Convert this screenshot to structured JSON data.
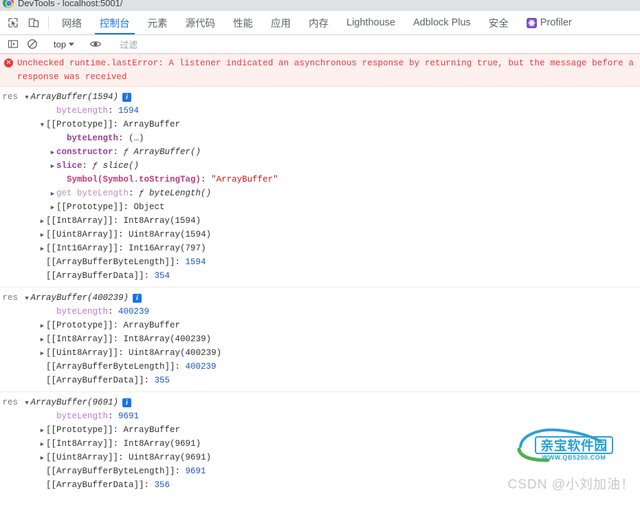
{
  "window": {
    "title": "DevTools - localhost:5001/",
    "chrome_logo": "chrome-logo-icon"
  },
  "toolbar": {
    "inspect_icon": "inspect-element-icon",
    "device_icon": "device-toolbar-icon",
    "tabs": [
      {
        "label": "网络",
        "active": false,
        "icon": null
      },
      {
        "label": "控制台",
        "active": true,
        "icon": null
      },
      {
        "label": "元素",
        "active": false,
        "icon": null
      },
      {
        "label": "源代码",
        "active": false,
        "icon": null
      },
      {
        "label": "性能",
        "active": false,
        "icon": null
      },
      {
        "label": "应用",
        "active": false,
        "icon": null
      },
      {
        "label": "内存",
        "active": false,
        "icon": null
      },
      {
        "label": "Lighthouse",
        "active": false,
        "icon": null
      },
      {
        "label": "Adblock Plus",
        "active": false,
        "icon": null
      },
      {
        "label": "安全",
        "active": false,
        "icon": null
      },
      {
        "label": "Profiler",
        "active": false,
        "icon": "profiler-icon"
      }
    ],
    "accent_color": "#1a73e8"
  },
  "filterbar": {
    "sidebar_toggle_icon": "console-sidebar-icon",
    "clear_icon": "clear-console-icon",
    "context": "top",
    "eye_icon": "live-expression-icon",
    "filter_placeholder": "过滤",
    "filter_value": ""
  },
  "console": {
    "error": {
      "badge": "error-icon",
      "text": "Unchecked runtime.lastError: A listener indicated an asynchronous response by returning true, but the message before a response was received",
      "color": "#e53935",
      "background": "#fff0f0"
    },
    "groups": [
      {
        "label": "res",
        "title": "ArrayBuffer(1594)",
        "info_icon": "info-icon",
        "expanded": true,
        "rows": [
          {
            "indent": 3,
            "arrow": "none",
            "key": "byteLength",
            "key_style": "prop",
            "value": "1594",
            "value_style": "num"
          },
          {
            "indent": 2,
            "arrow": "open",
            "key": "[[Prototype]]",
            "key_style": "plain",
            "value": "ArrayBuffer",
            "value_style": "obj"
          },
          {
            "indent": 4,
            "arrow": "none",
            "key": "byteLength",
            "key_style": "proto",
            "value": "(…)",
            "value_style": "dots"
          },
          {
            "indent": 3,
            "arrow": "closed",
            "key": "constructor",
            "key_style": "proto",
            "value": "ƒ ArrayBuffer()",
            "value_style": "fn"
          },
          {
            "indent": 3,
            "arrow": "closed",
            "key": "slice",
            "key_style": "proto",
            "value": "ƒ slice()",
            "value_style": "fn"
          },
          {
            "indent": 4,
            "arrow": "none",
            "key": "Symbol(Symbol.toStringTag)",
            "key_style": "sym",
            "value": "\"ArrayBuffer\"",
            "value_style": "str"
          },
          {
            "indent": 3,
            "arrow": "closed",
            "key": "get byteLength",
            "key_style": "getter",
            "value": "ƒ byteLength()",
            "value_style": "fn"
          },
          {
            "indent": 3,
            "arrow": "closed",
            "key": "[[Prototype]]",
            "key_style": "plain",
            "value": "Object",
            "value_style": "obj"
          },
          {
            "indent": 2,
            "arrow": "closed",
            "key": "[[Int8Array]]",
            "key_style": "plain",
            "value": "Int8Array(1594)",
            "value_style": "obj"
          },
          {
            "indent": 2,
            "arrow": "closed",
            "key": "[[Uint8Array]]",
            "key_style": "plain",
            "value": "Uint8Array(1594)",
            "value_style": "obj"
          },
          {
            "indent": 2,
            "arrow": "closed",
            "key": "[[Int16Array]]",
            "key_style": "plain",
            "value": "Int16Array(797)",
            "value_style": "obj"
          },
          {
            "indent": 2,
            "arrow": "none",
            "key": "[[ArrayBufferByteLength]]",
            "key_style": "plain",
            "value": "1594",
            "value_style": "num"
          },
          {
            "indent": 2,
            "arrow": "none",
            "key": "[[ArrayBufferData]]",
            "key_style": "plain",
            "value": "354",
            "value_style": "num"
          }
        ]
      },
      {
        "label": "res",
        "title": "ArrayBuffer(400239)",
        "info_icon": "info-icon",
        "expanded": true,
        "rows": [
          {
            "indent": 3,
            "arrow": "none",
            "key": "byteLength",
            "key_style": "prop",
            "value": "400239",
            "value_style": "num"
          },
          {
            "indent": 2,
            "arrow": "closed",
            "key": "[[Prototype]]",
            "key_style": "plain",
            "value": "ArrayBuffer",
            "value_style": "obj"
          },
          {
            "indent": 2,
            "arrow": "closed",
            "key": "[[Int8Array]]",
            "key_style": "plain",
            "value": "Int8Array(400239)",
            "value_style": "obj"
          },
          {
            "indent": 2,
            "arrow": "closed",
            "key": "[[Uint8Array]]",
            "key_style": "plain",
            "value": "Uint8Array(400239)",
            "value_style": "obj"
          },
          {
            "indent": 2,
            "arrow": "none",
            "key": "[[ArrayBufferByteLength]]",
            "key_style": "plain",
            "value": "400239",
            "value_style": "num"
          },
          {
            "indent": 2,
            "arrow": "none",
            "key": "[[ArrayBufferData]]",
            "key_style": "plain",
            "value": "355",
            "value_style": "num"
          }
        ]
      },
      {
        "label": "res",
        "title": "ArrayBuffer(9691)",
        "info_icon": "info-icon",
        "expanded": true,
        "rows": [
          {
            "indent": 3,
            "arrow": "none",
            "key": "byteLength",
            "key_style": "prop",
            "value": "9691",
            "value_style": "num"
          },
          {
            "indent": 2,
            "arrow": "closed",
            "key": "[[Prototype]]",
            "key_style": "plain",
            "value": "ArrayBuffer",
            "value_style": "obj"
          },
          {
            "indent": 2,
            "arrow": "closed",
            "key": "[[Int8Array]]",
            "key_style": "plain",
            "value": "Int8Array(9691)",
            "value_style": "obj"
          },
          {
            "indent": 2,
            "arrow": "closed",
            "key": "[[Uint8Array]]",
            "key_style": "plain",
            "value": "Uint8Array(9691)",
            "value_style": "obj"
          },
          {
            "indent": 2,
            "arrow": "none",
            "key": "[[ArrayBufferByteLength]]",
            "key_style": "plain",
            "value": "9691",
            "value_style": "num"
          },
          {
            "indent": 2,
            "arrow": "none",
            "key": "[[ArrayBufferData]]",
            "key_style": "plain",
            "value": "356",
            "value_style": "num"
          }
        ]
      }
    ],
    "prompt": ">"
  },
  "watermarks": {
    "logo_text": "亲宝软件园",
    "logo_url": "WWW.QB5200.COM",
    "csdn": "CSDN @小刘加油！"
  }
}
